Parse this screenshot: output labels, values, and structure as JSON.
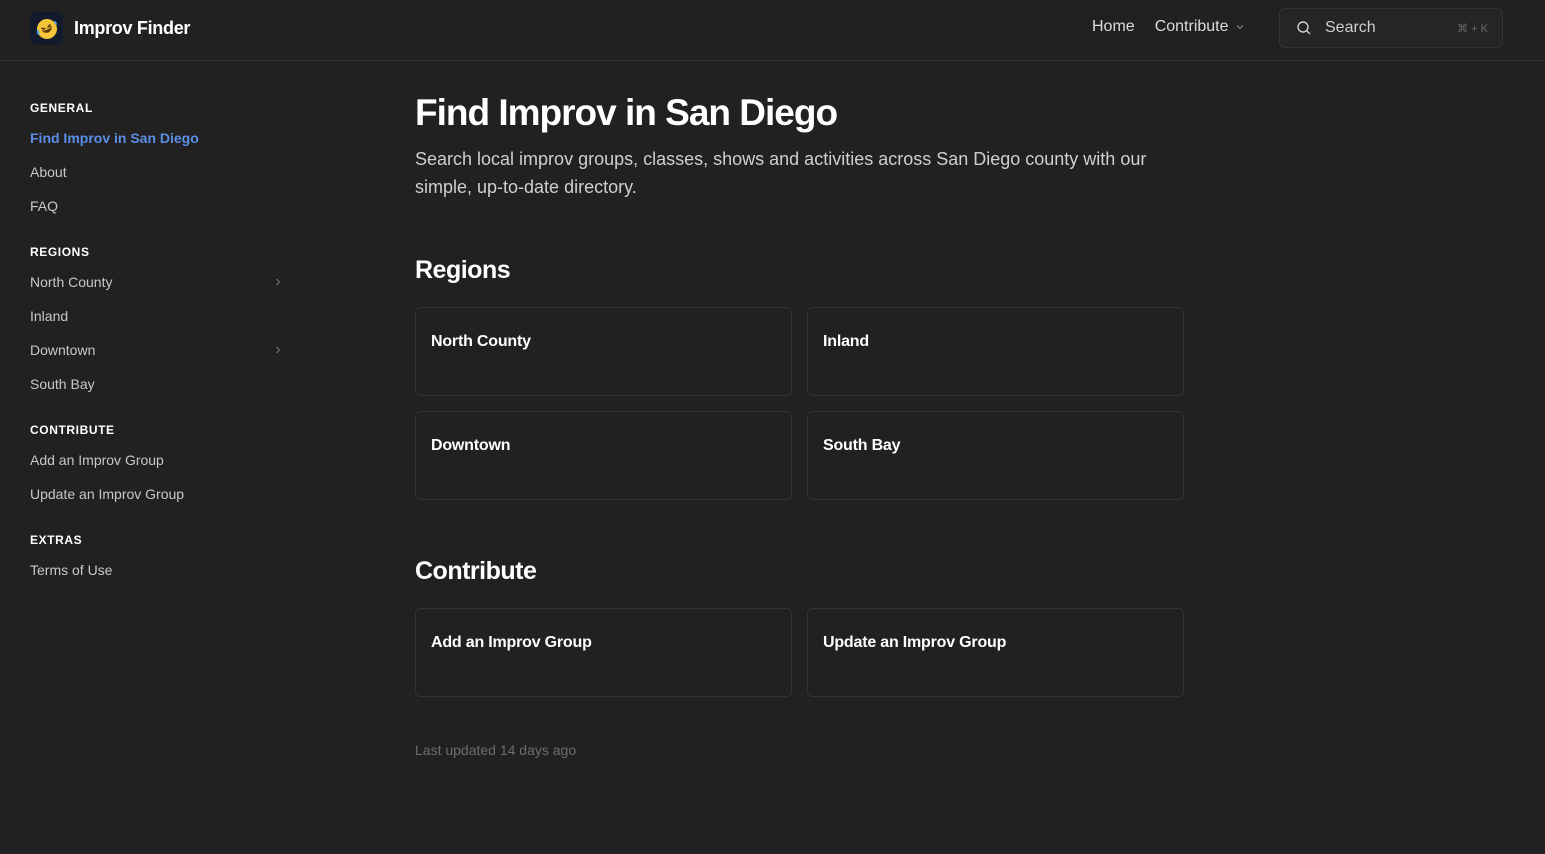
{
  "header": {
    "brand": "Improv Finder",
    "logo_icon": "rolling-on-floor-laughing-emoji",
    "nav": [
      {
        "label": "Home"
      },
      {
        "label": "Contribute",
        "has_dropdown": true
      }
    ],
    "search": {
      "placeholder": "Search",
      "shortcut": "⌘ + K"
    }
  },
  "sidebar": {
    "sections": [
      {
        "heading": "GENERAL",
        "items": [
          {
            "label": "Find Improv in San Diego",
            "active": true
          },
          {
            "label": "About"
          },
          {
            "label": "FAQ"
          }
        ]
      },
      {
        "heading": "REGIONS",
        "items": [
          {
            "label": "North County",
            "expandable": true
          },
          {
            "label": "Inland"
          },
          {
            "label": "Downtown",
            "expandable": true
          },
          {
            "label": "South Bay"
          }
        ]
      },
      {
        "heading": "CONTRIBUTE",
        "items": [
          {
            "label": "Add an Improv Group"
          },
          {
            "label": "Update an Improv Group"
          }
        ]
      },
      {
        "heading": "EXTRAS",
        "items": [
          {
            "label": "Terms of Use"
          }
        ]
      }
    ]
  },
  "main": {
    "title": "Find Improv in San Diego",
    "description": "Search local improv groups, classes, shows and activities across San Diego county with our simple, up-to-date directory.",
    "regions": {
      "title": "Regions",
      "cards": [
        {
          "label": "North County"
        },
        {
          "label": "Inland"
        },
        {
          "label": "Downtown"
        },
        {
          "label": "South Bay"
        }
      ]
    },
    "contribute": {
      "title": "Contribute",
      "cards": [
        {
          "label": "Add an Improv Group"
        },
        {
          "label": "Update an Improv Group"
        }
      ]
    },
    "last_updated": "Last updated 14 days ago"
  },
  "colors": {
    "background": "#212121",
    "accent": "#5b8ee6",
    "border": "#333333",
    "muted_text": "#6d6d6d"
  }
}
